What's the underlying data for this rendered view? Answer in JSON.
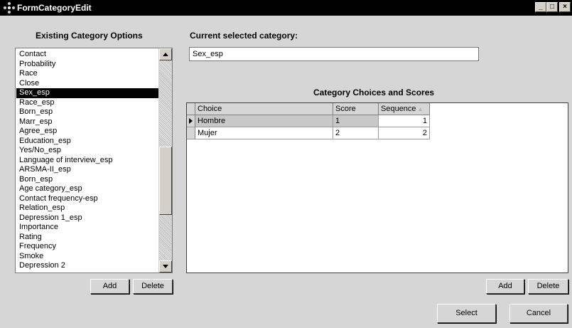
{
  "window": {
    "title": "FormCategoryEdit"
  },
  "left_panel": {
    "heading": "Existing Category Options",
    "items": [
      "Contact",
      "Probability",
      "Race",
      "Close",
      "Sex_esp",
      "Race_esp",
      "Born_esp",
      "Marr_esp",
      "Agree_esp",
      "Education_esp",
      "Yes/No_esp",
      "Language of interview_esp",
      "ARSMA-II_esp",
      "Born_esp",
      "Age category_esp",
      "Contact frequency-esp",
      "Relation_esp",
      "Depression 1_esp",
      "Importance",
      "Rating",
      "Frequency",
      "Smoke",
      "Depression 2"
    ],
    "selected": "Sex_esp",
    "add_label": "Add",
    "delete_label": "Delete"
  },
  "current": {
    "label": "Current selected category:",
    "value": "Sex_esp"
  },
  "grid": {
    "title": "Category Choices and Scores",
    "columns": [
      "Choice",
      "Score",
      "Sequence"
    ],
    "rows": [
      {
        "choice": "Hombre",
        "score": "1",
        "sequence": "1"
      },
      {
        "choice": "Mujer",
        "score": "2",
        "sequence": "2"
      }
    ],
    "add_label": "Add",
    "delete_label": "Delete"
  },
  "footer": {
    "select_label": "Select",
    "cancel_label": "Cancel"
  }
}
